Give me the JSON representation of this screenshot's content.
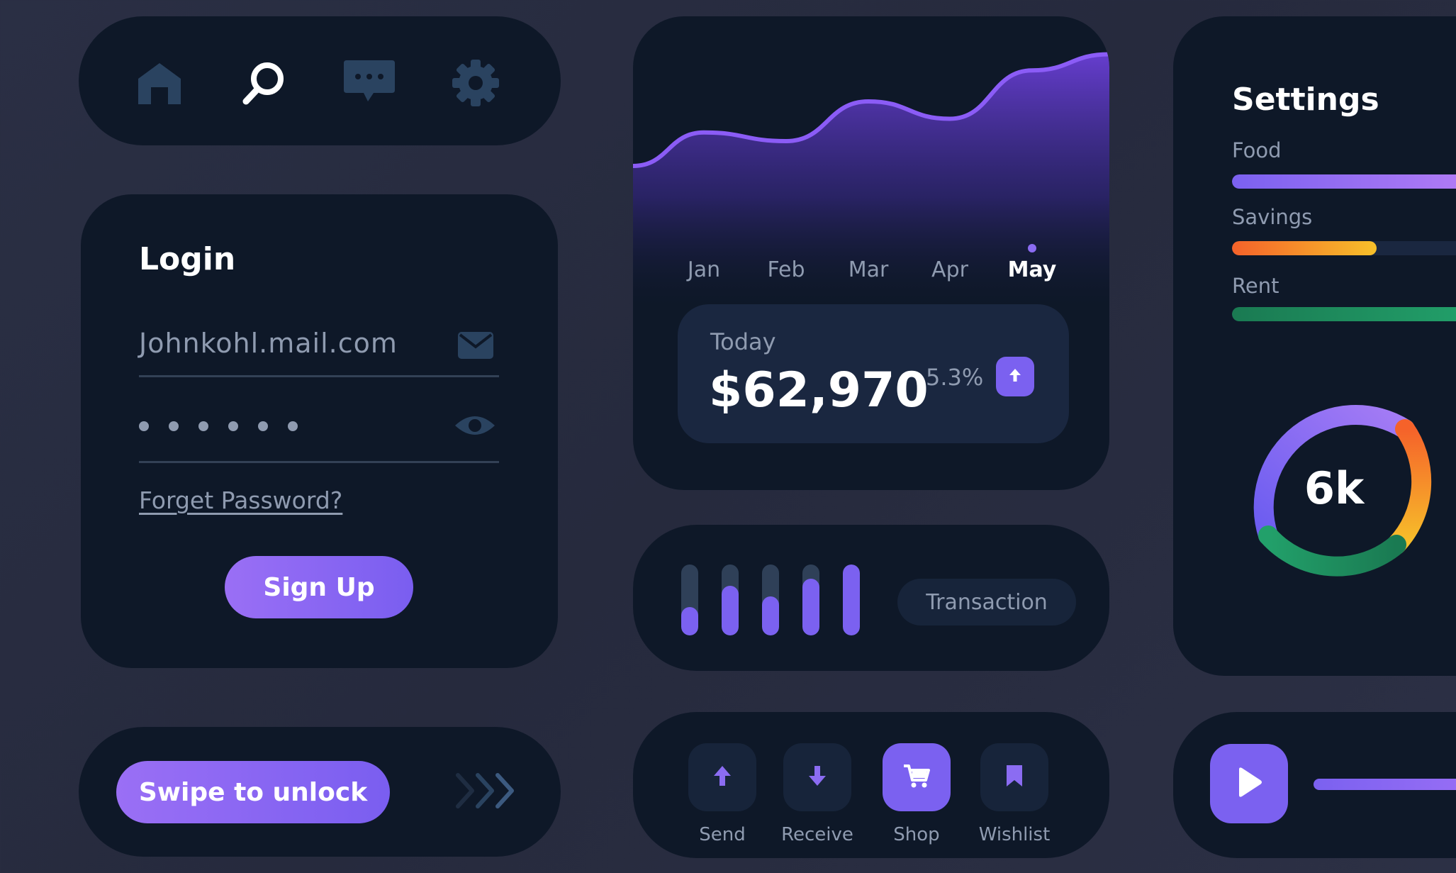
{
  "nav": {
    "icons": [
      "home-icon",
      "search-icon",
      "chat-icon",
      "gear-icon"
    ],
    "active": "search-icon"
  },
  "login": {
    "title": "Login",
    "email_value": "Johnkohl.mail.com",
    "password_dots": 6,
    "forget_label": "Forget Password?",
    "signup_label": "Sign Up"
  },
  "swipe": {
    "label": "Swipe to unlock"
  },
  "chart": {
    "months": [
      "Jan",
      "Feb",
      "Mar",
      "Apr",
      "May"
    ],
    "active_month": "May",
    "today_label": "Today",
    "today_value": "$62,970",
    "change_pct": "5.3%"
  },
  "chart_data": {
    "type": "area",
    "categories": [
      "Jan",
      "Feb",
      "Mar",
      "Apr",
      "May"
    ],
    "series": [
      {
        "values": [
          55,
          48,
          80,
          66,
          105
        ]
      }
    ],
    "xlabel": "",
    "ylabel": "",
    "grid": false
  },
  "transaction": {
    "label": "Transaction",
    "bar_levels": [
      0.4,
      0.7,
      0.55,
      0.8,
      1.0
    ]
  },
  "actions": {
    "items": [
      {
        "label": "Send",
        "icon": "arrow-up-icon"
      },
      {
        "label": "Receive",
        "icon": "arrow-down-icon"
      },
      {
        "label": "Shop",
        "icon": "cart-icon"
      },
      {
        "label": "Wishlist",
        "icon": "bookmark-icon"
      }
    ],
    "active": "Shop"
  },
  "settings": {
    "title": "Settings",
    "items": [
      {
        "label": "Food",
        "level": 1.0,
        "color": "#8b6cf2"
      },
      {
        "label": "Savings",
        "level": 0.6,
        "color": "#f59a2a"
      },
      {
        "label": "Rent",
        "level": 1.0,
        "color": "#1f8a5c"
      }
    ],
    "donut_value": "6k"
  },
  "player": {
    "play_icon": "play-icon"
  },
  "colors": {
    "accent": "#7b61f0",
    "card": "#0e1828",
    "muted_text": "#8f9bb0"
  }
}
